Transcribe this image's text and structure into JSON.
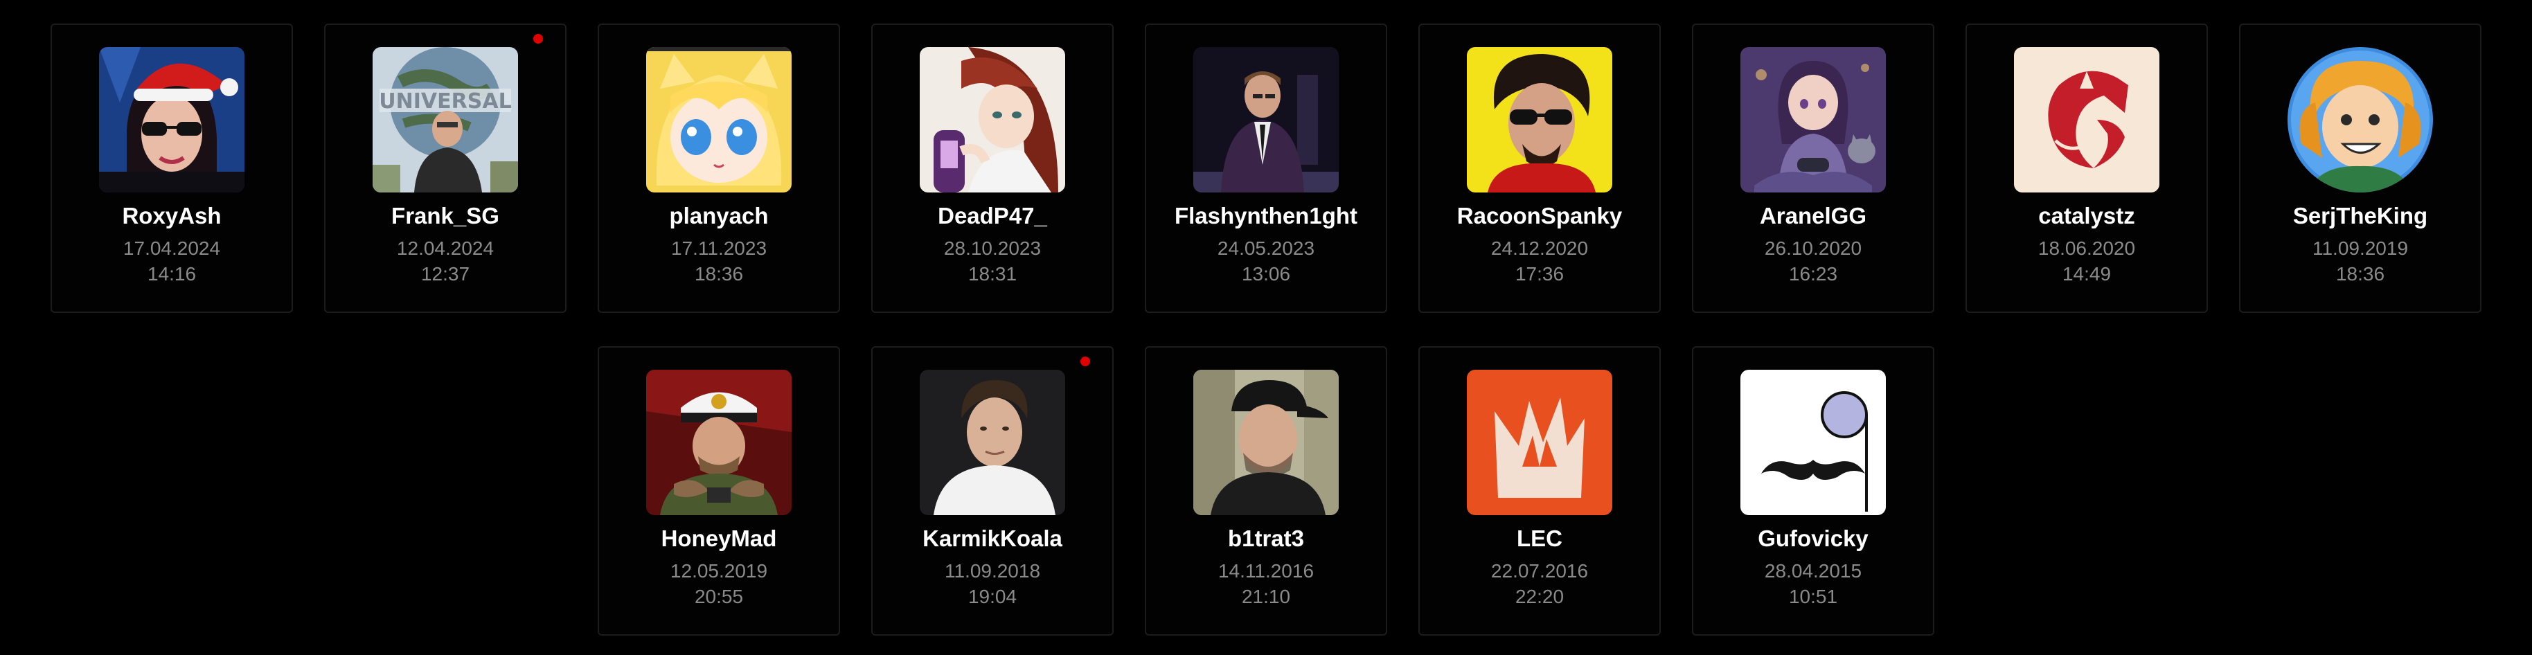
{
  "users": [
    {
      "name": "RoxyAsh",
      "date": "17.04.2024",
      "time": "14:16",
      "avatar_icon": "woman-santa-hat-avatar",
      "unread": false
    },
    {
      "name": "Frank_SG",
      "date": "12.04.2024",
      "time": "12:37",
      "avatar_icon": "man-universal-globe-avatar",
      "unread": true
    },
    {
      "name": "planyach",
      "date": "17.11.2023",
      "time": "18:36",
      "avatar_icon": "anime-blonde-girl-avatar",
      "unread": false
    },
    {
      "name": "DeadP47_",
      "date": "28.10.2023",
      "time": "18:31",
      "avatar_icon": "anime-redhair-character-avatar",
      "unread": false
    },
    {
      "name": "Flashynthen1ght",
      "date": "24.05.2023",
      "time": "13:06",
      "avatar_icon": "man-suit-stage-avatar",
      "unread": false
    },
    {
      "name": "RacoonSpanky",
      "date": "24.12.2020",
      "time": "17:36",
      "avatar_icon": "man-sunglasses-yellow-avatar",
      "unread": false
    },
    {
      "name": "AranelGG",
      "date": "26.10.2020",
      "time": "16:23",
      "avatar_icon": "anime-gamer-girl-avatar",
      "unread": false
    },
    {
      "name": "catalystz",
      "date": "18.06.2020",
      "time": "14:49",
      "avatar_icon": "red-fox-logo-avatar",
      "unread": false
    },
    {
      "name": "SerjTheKing",
      "date": "11.09.2019",
      "time": "18:36",
      "avatar_icon": "cartoon-blonde-man-avatar",
      "unread": false
    },
    {
      "name": "HoneyMad",
      "date": "12.05.2019",
      "time": "20:55",
      "avatar_icon": "navy-captain-avatar",
      "unread": false
    },
    {
      "name": "KarmikKoala",
      "date": "11.09.2018",
      "time": "19:04",
      "avatar_icon": "man-white-shirt-avatar",
      "unread": true
    },
    {
      "name": "b1trat3",
      "date": "14.11.2016",
      "time": "21:10",
      "avatar_icon": "man-black-cap-avatar",
      "unread": false
    },
    {
      "name": "LEC",
      "date": "22.07.2016",
      "time": "22:20",
      "avatar_icon": "lec-crown-logo-avatar",
      "unread": false
    },
    {
      "name": "Gufovicky",
      "date": "28.04.2015",
      "time": "10:51",
      "avatar_icon": "mustache-monocle-avatar",
      "unread": false
    }
  ],
  "colors": {
    "background": "#000000",
    "card_border": "#1c1c1c",
    "name_text": "#ffffff",
    "meta_text": "#8a8a8a",
    "unread_dot": "#e00000"
  }
}
